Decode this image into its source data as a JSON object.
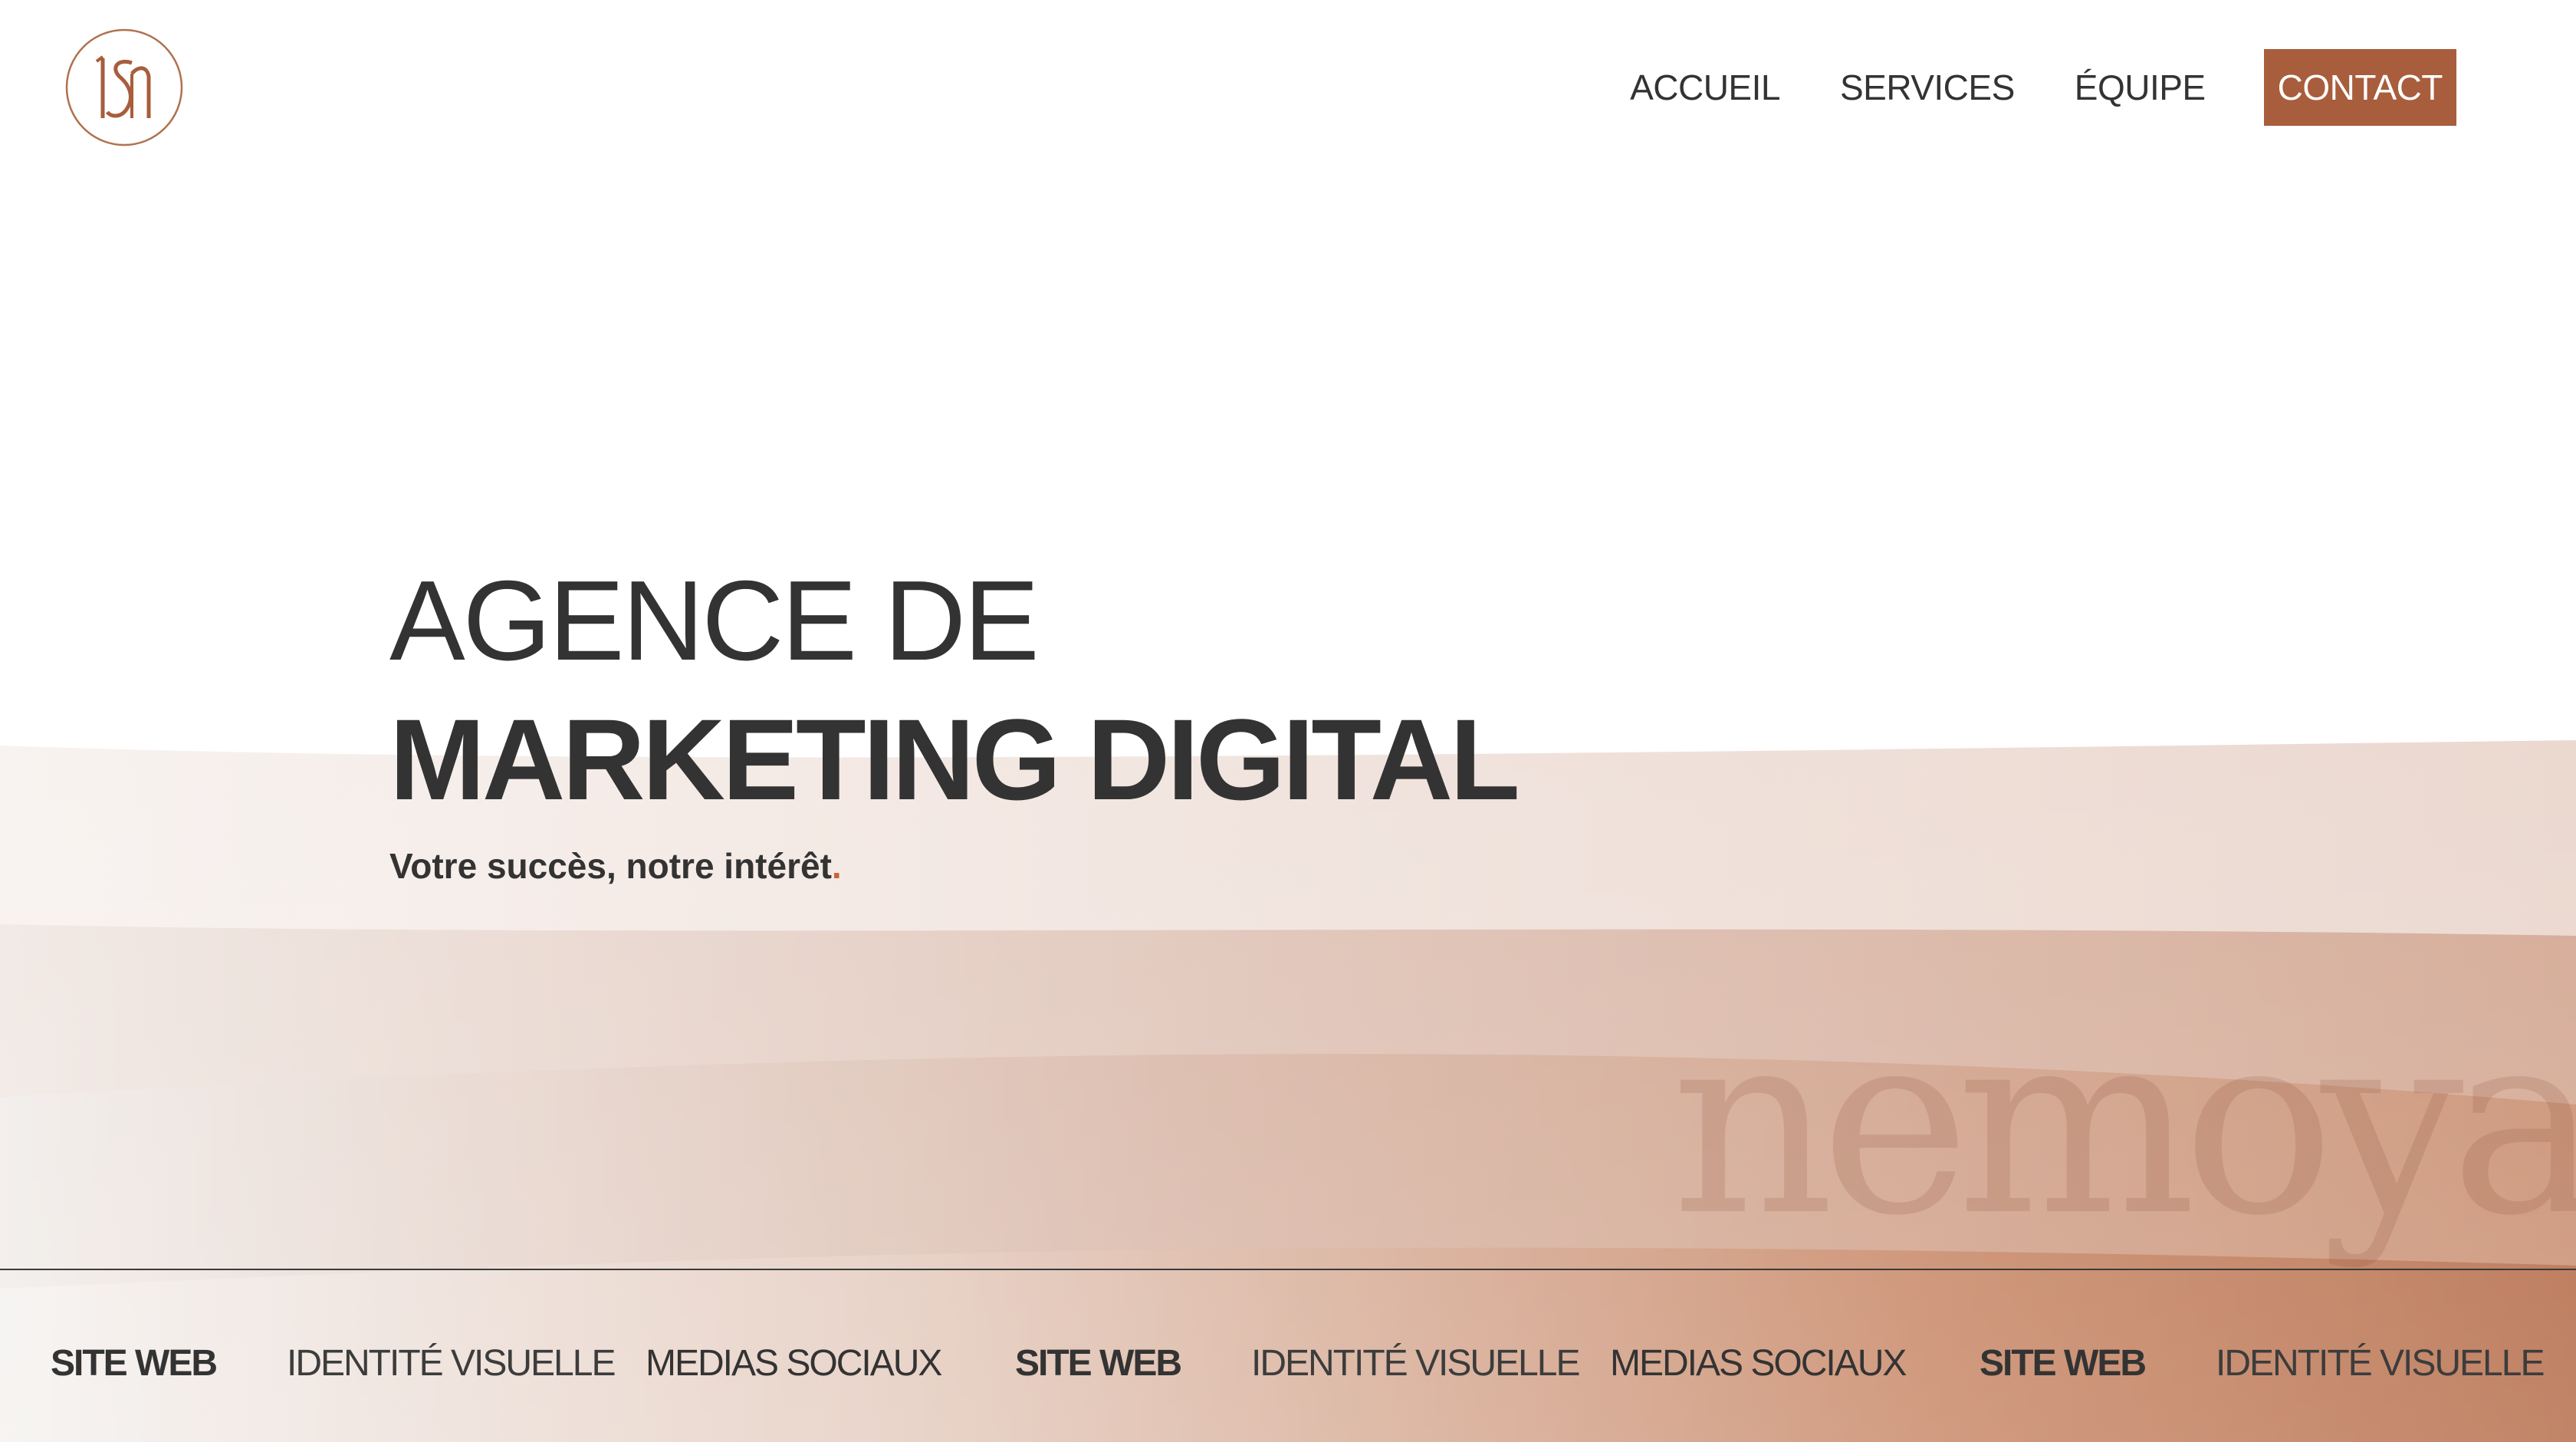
{
  "header": {
    "logo_alt": "ls",
    "nav": [
      {
        "label": "ACCUEIL"
      },
      {
        "label": "SERVICES"
      },
      {
        "label": "ÉQUIPE"
      },
      {
        "label": "CONTACT"
      }
    ]
  },
  "hero": {
    "line1": "AGENCE DE",
    "line2": "MARKETING DIGITAL",
    "tagline": "Votre succès, notre intérêt",
    "tagline_dot": "."
  },
  "watermark": "nemoya.",
  "marquee": {
    "items": [
      {
        "label": "SITE WEB",
        "style": "bold"
      },
      {
        "label": "IDENTITÉ VISUELLE",
        "style": "light"
      },
      {
        "label": "MEDIAS SOCIAUX",
        "style": "medium"
      },
      {
        "label": "SITE WEB",
        "style": "bold"
      },
      {
        "label": "IDENTITÉ VISUELLE",
        "style": "light"
      },
      {
        "label": "MEDIAS SOCIAUX",
        "style": "medium"
      },
      {
        "label": "SITE WEB",
        "style": "bold"
      },
      {
        "label": "IDENTITÉ VISUELLE",
        "style": "light"
      }
    ]
  },
  "colors": {
    "accent": "#a85d3c",
    "text": "#333333",
    "tagline_dot": "#c9633a"
  }
}
